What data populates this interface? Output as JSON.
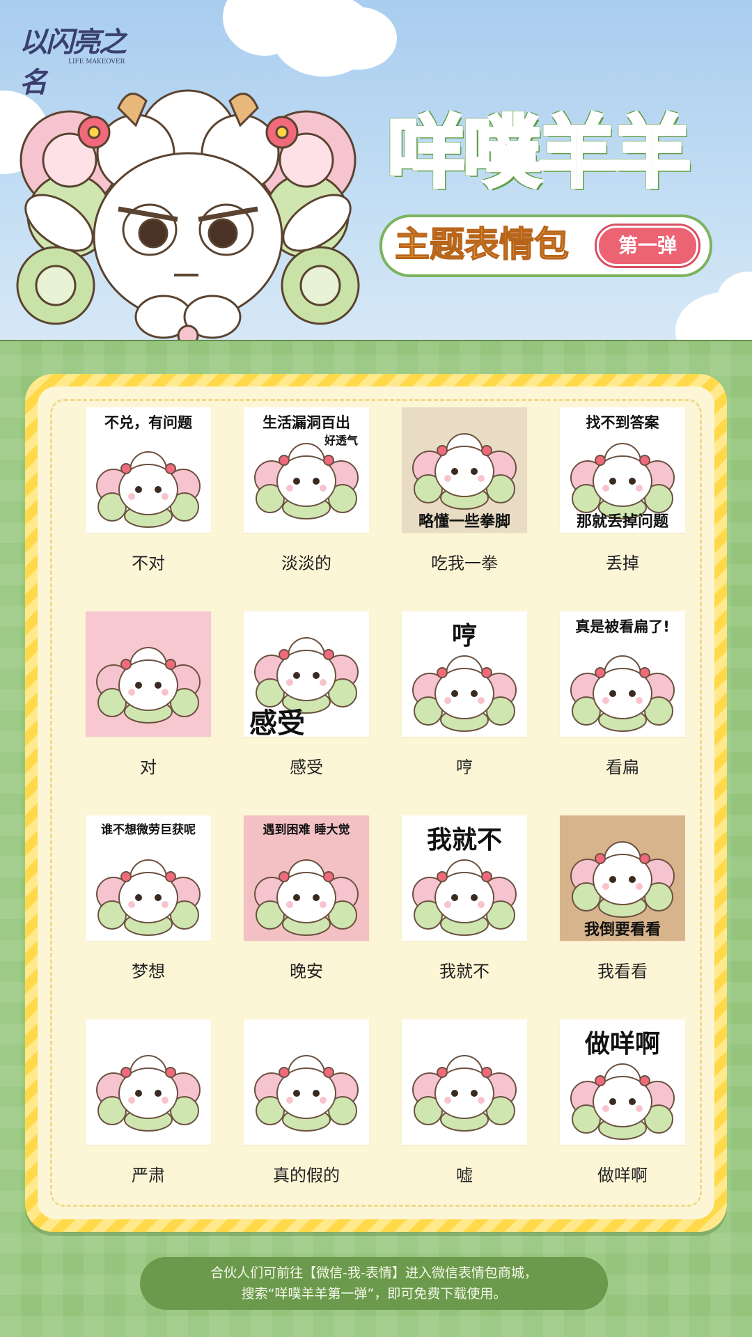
{
  "header": {
    "logo_text": "以闪亮之名",
    "logo_sub": "LIFE MAKEOVER",
    "title_main": "咩噗羊羊",
    "title_sub": "主题表情包",
    "badge": "第一弹"
  },
  "stickers": [
    {
      "caption": "不兑，有问题",
      "caption2": "",
      "label": "不对",
      "bg": "#ffffff"
    },
    {
      "caption": "生活漏洞百出",
      "caption2": "好透气",
      "label": "淡淡的",
      "bg": "#ffffff"
    },
    {
      "caption": "",
      "caption2": "略懂一些拳脚",
      "label": "吃我一拳",
      "bg": "#e9dcc4"
    },
    {
      "caption": "找不到答案",
      "caption2": "那就丢掉问题",
      "label": "丢掉",
      "bg": "#ffffff"
    },
    {
      "caption": "",
      "caption2": "",
      "label": "对",
      "bg": "#f7c8d0"
    },
    {
      "caption": "",
      "caption2": "感受",
      "label": "感受",
      "bg": "#ffffff"
    },
    {
      "caption": "哼",
      "caption2": "",
      "label": "哼",
      "bg": "#ffffff"
    },
    {
      "caption": "真是被看扁了!",
      "caption2": "",
      "label": "看扁",
      "bg": "#ffffff"
    },
    {
      "caption": "谁不想微劳巨获呢",
      "caption2": "",
      "label": "梦想",
      "bg": "#ffffff"
    },
    {
      "caption": "遇到困难 睡大觉",
      "caption2": "",
      "label": "晚安",
      "bg": "#f3c1c4"
    },
    {
      "caption": "我就不",
      "caption2": "",
      "label": "我就不",
      "bg": "#ffffff"
    },
    {
      "caption": "",
      "caption2": "我倒要看看",
      "label": "我看看",
      "bg": "#d8b48c"
    },
    {
      "caption": "",
      "caption2": "",
      "label": "严肃",
      "bg": "#ffffff"
    },
    {
      "caption": "",
      "caption2": "",
      "label": "真的假的",
      "bg": "#ffffff"
    },
    {
      "caption": "",
      "caption2": "",
      "label": "嘘",
      "bg": "#ffffff"
    },
    {
      "caption": "做咩啊",
      "caption2": "",
      "label": "做咩啊",
      "bg": "#ffffff"
    }
  ],
  "footer": {
    "line1": "合伙人们可前往【微信-我-表情】进入微信表情包商城，",
    "line2": "搜索“咩噗羊羊第一弹”，即可免费下载使用。"
  },
  "colors": {
    "sky": "#a9cdef",
    "grass": "#95c57c",
    "panel_stripe": "#ffd94a",
    "panel_inner": "#fdf6d6",
    "footer_pill": "#6c9a4c",
    "title_green": "#8fcf6a",
    "badge_pink": "#ec6374"
  }
}
